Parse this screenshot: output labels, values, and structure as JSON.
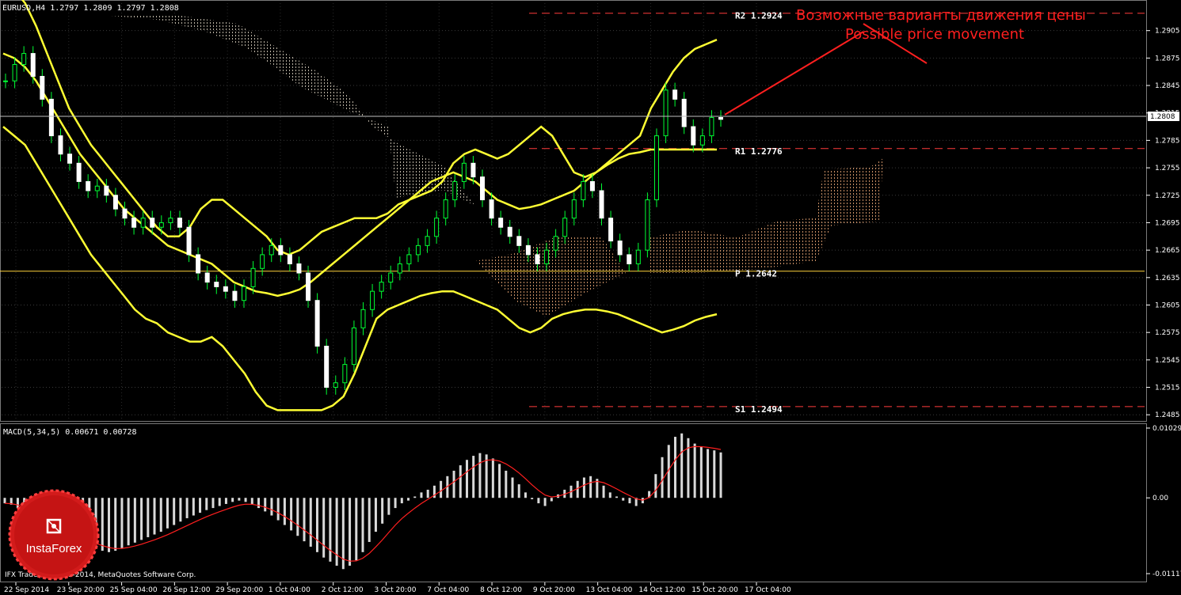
{
  "chart_data": [
    {
      "type": "line",
      "title": "EURUSD,H4  1.2797 1.2809 1.2797 1.2808",
      "annotation_ru": "Возможные варианты движения цены",
      "annotation_en": "Possible price movement",
      "ylim": [
        1.248,
        1.2935
      ],
      "yticks": [
        "1.2905",
        "1.2875",
        "1.2845",
        "1.2815",
        "1.2785",
        "1.2755",
        "1.2725",
        "1.2695",
        "1.2665",
        "1.2635",
        "1.2605",
        "1.2575",
        "1.2545",
        "1.2515",
        "1.2485"
      ],
      "current_price": "1.2808",
      "xticks": [
        "22 Sep 2014",
        "23 Sep 20:00",
        "25 Sep 04:00",
        "26 Sep 12:00",
        "29 Sep 20:00",
        "1 Oct 04:00",
        "2 Oct 12:00",
        "3 Oct 20:00",
        "7 Oct 04:00",
        "8 Oct 12:00",
        "9 Oct 20:00",
        "13 Oct 04:00",
        "14 Oct 12:00",
        "15 Oct 20:00",
        "17 Oct 04:00"
      ],
      "levels": [
        {
          "name": "R2",
          "label": "R2 1.2924",
          "value": 1.2924,
          "color": "#ff3c3c",
          "style": "dash"
        },
        {
          "name": "R1",
          "label": "R1 1.2776",
          "value": 1.2776,
          "color": "#ff3c3c",
          "style": "dash"
        },
        {
          "name": "P",
          "label": "P 1.2642",
          "value": 1.2642,
          "color": "#ffd23c",
          "style": "solid"
        },
        {
          "name": "S1",
          "label": "S1 1.2494",
          "value": 1.2494,
          "color": "#ff3c3c",
          "style": "dash"
        }
      ],
      "close": [
        1.285,
        1.2868,
        1.288,
        1.2855,
        1.283,
        1.279,
        1.277,
        1.276,
        1.274,
        1.273,
        1.2735,
        1.2725,
        1.271,
        1.27,
        1.269,
        1.27,
        1.269,
        1.2695,
        1.27,
        1.269,
        1.266,
        1.264,
        1.263,
        1.2625,
        1.262,
        1.261,
        1.2625,
        1.2645,
        1.266,
        1.267,
        1.266,
        1.265,
        1.264,
        1.261,
        1.256,
        1.2515,
        1.252,
        1.254,
        1.258,
        1.26,
        1.262,
        1.263,
        1.264,
        1.265,
        1.266,
        1.267,
        1.268,
        1.27,
        1.272,
        1.274,
        1.276,
        1.2745,
        1.272,
        1.27,
        1.269,
        1.268,
        1.267,
        1.266,
        1.265,
        1.2665,
        1.268,
        1.27,
        1.272,
        1.274,
        1.273,
        1.27,
        1.2675,
        1.266,
        1.265,
        1.2665,
        1.272,
        1.279,
        1.284,
        1.283,
        1.28,
        1.278,
        1.279,
        1.281,
        1.2808
      ],
      "bollinger_upper": [
        1.296,
        1.295,
        1.2935,
        1.291,
        1.288,
        1.285,
        1.282,
        1.28,
        1.278,
        1.2765,
        1.275,
        1.2735,
        1.272,
        1.2705,
        1.269,
        1.268,
        1.268,
        1.269,
        1.271,
        1.272,
        1.272,
        1.271,
        1.27,
        1.269,
        1.268,
        1.2665,
        1.266,
        1.2665,
        1.2675,
        1.2685,
        1.269,
        1.2695,
        1.27,
        1.27,
        1.27,
        1.2705,
        1.2715,
        1.272,
        1.2725,
        1.273,
        1.274,
        1.276,
        1.277,
        1.2775,
        1.277,
        1.2765,
        1.277,
        1.278,
        1.279,
        1.28,
        1.279,
        1.277,
        1.275,
        1.2745,
        1.275,
        1.276,
        1.277,
        1.278,
        1.279,
        1.282,
        1.284,
        1.286,
        1.2875,
        1.2885,
        1.289,
        1.2895
      ],
      "bollinger_middle": [
        1.288,
        1.2875,
        1.2865,
        1.285,
        1.283,
        1.281,
        1.279,
        1.277,
        1.2755,
        1.274,
        1.2725,
        1.271,
        1.27,
        1.269,
        1.268,
        1.267,
        1.2665,
        1.266,
        1.2655,
        1.265,
        1.264,
        1.263,
        1.2625,
        1.262,
        1.2618,
        1.2615,
        1.2618,
        1.2622,
        1.263,
        1.264,
        1.265,
        1.266,
        1.267,
        1.268,
        1.269,
        1.27,
        1.271,
        1.272,
        1.273,
        1.274,
        1.2745,
        1.275,
        1.2745,
        1.274,
        1.273,
        1.272,
        1.2715,
        1.271,
        1.2712,
        1.2715,
        1.272,
        1.2725,
        1.273,
        1.274,
        1.275,
        1.2758,
        1.2765,
        1.277,
        1.2772,
        1.2775,
        1.2775,
        1.2775,
        1.2775,
        1.2775,
        1.2775,
        1.2775
      ],
      "bollinger_lower": [
        1.28,
        1.279,
        1.278,
        1.276,
        1.274,
        1.272,
        1.27,
        1.268,
        1.266,
        1.2645,
        1.263,
        1.2615,
        1.26,
        1.259,
        1.2585,
        1.2575,
        1.257,
        1.2565,
        1.2565,
        1.257,
        1.256,
        1.2545,
        1.253,
        1.251,
        1.2495,
        1.249,
        1.249,
        1.249,
        1.249,
        1.249,
        1.2495,
        1.2505,
        1.253,
        1.256,
        1.259,
        1.26,
        1.2605,
        1.261,
        1.2615,
        1.2618,
        1.262,
        1.262,
        1.2615,
        1.261,
        1.2605,
        1.26,
        1.259,
        1.258,
        1.2575,
        1.258,
        1.259,
        1.2595,
        1.2598,
        1.26,
        1.26,
        1.2598,
        1.2595,
        1.259,
        1.2585,
        1.258,
        1.2575,
        1.2578,
        1.2582,
        1.2588,
        1.2592,
        1.2595
      ],
      "macd_label": "MACD(5,34,5) 0.00671 0.00728",
      "macd_yticks": [
        "0.01029",
        "0.00",
        "-0.01117"
      ],
      "macd_ylim": [
        -0.01117,
        0.01029
      ],
      "macd_histogram": [
        -0.0008,
        -0.001,
        -0.0015,
        -0.002,
        -0.0025,
        -0.003,
        -0.0035,
        -0.0045,
        -0.0055,
        -0.006,
        -0.0065,
        -0.0068,
        -0.007,
        -0.0072,
        -0.0075,
        -0.0078,
        -0.008,
        -0.0078,
        -0.0074,
        -0.007,
        -0.0066,
        -0.0062,
        -0.0058,
        -0.0054,
        -0.005,
        -0.0045,
        -0.004,
        -0.0035,
        -0.003,
        -0.0026,
        -0.0022,
        -0.0018,
        -0.0015,
        -0.0012,
        -0.0009,
        -0.0006,
        -0.0004,
        -0.0006,
        -0.001,
        -0.0015,
        -0.002,
        -0.0026,
        -0.0033,
        -0.004,
        -0.0048,
        -0.0056,
        -0.0064,
        -0.0072,
        -0.008,
        -0.0088,
        -0.0094,
        -0.01,
        -0.0105,
        -0.01,
        -0.0092,
        -0.008,
        -0.0065,
        -0.005,
        -0.0038,
        -0.0025,
        -0.0015,
        -0.0008,
        -0.0004,
        0.0002,
        0.0008,
        0.0012,
        0.0018,
        0.0025,
        0.0032,
        0.004,
        0.0048,
        0.0056,
        0.0062,
        0.0066,
        0.0064,
        0.0058,
        0.005,
        0.004,
        0.003,
        0.002,
        0.0008,
        -0.0002,
        -0.0008,
        -0.0012,
        -0.0005,
        0.0005,
        0.0012,
        0.0018,
        0.0025,
        0.003,
        0.0032,
        0.0028,
        0.0018,
        0.0008,
        0.0002,
        -0.0004,
        -0.0008,
        -0.0012,
        -0.0008,
        0.001,
        0.0035,
        0.006,
        0.0078,
        0.009,
        0.0095,
        0.0088,
        0.008,
        0.0075,
        0.0072,
        0.007,
        0.0067
      ]
    }
  ],
  "footer": {
    "logo_text": "InstaForex",
    "copyright": "IFX Trader, © 2001-2014, MetaQuotes Software Corp."
  }
}
